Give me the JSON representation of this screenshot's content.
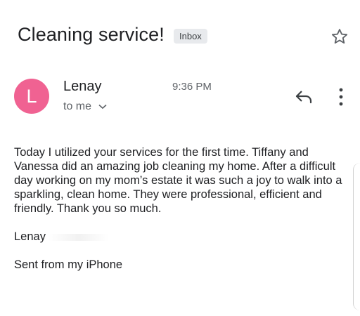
{
  "email": {
    "subject": "Cleaning service!",
    "label": "Inbox",
    "sender": {
      "name": "Lenay",
      "initial": "L",
      "avatar_color": "#f06292",
      "time": "9:36 PM",
      "recipient": "to me"
    },
    "body": {
      "paragraph": "Today I utilized your services for the first time.  Tiffany and Vanessa did an amazing job cleaning my home.  After a difficult day working on my mom’s estate it was such a joy to walk into a sparkling, clean home.  They were professional, efficient and friendly.  Thank you so much.",
      "signature": "Lenay",
      "footer": "Sent from my iPhone"
    }
  },
  "icons": {
    "star": "star-outline-icon",
    "reply": "reply-icon",
    "more": "more-vertical-icon",
    "expand": "chevron-down-icon"
  }
}
